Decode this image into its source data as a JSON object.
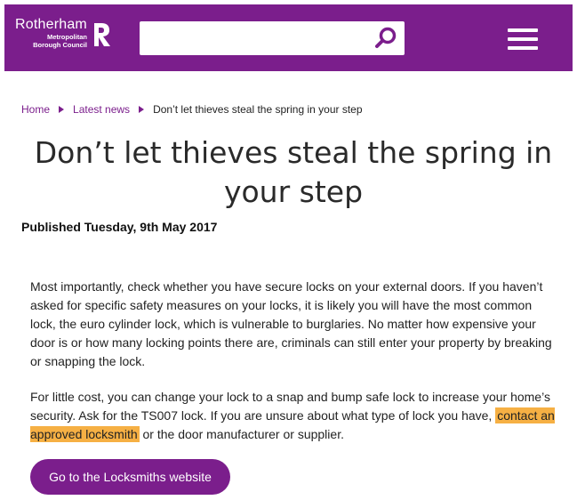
{
  "header": {
    "logo": {
      "name": "Rotherham",
      "sub_line1": "Metropolitan",
      "sub_line2": "Borough Council",
      "icon": "rotherham-r-mark-icon"
    },
    "search": {
      "value": "",
      "placeholder": "",
      "icon": "search-icon"
    },
    "menu_icon": "hamburger-menu-icon",
    "background": "#7b1e8c"
  },
  "breadcrumb": {
    "items": [
      "Home",
      "Latest news"
    ],
    "current": "Don’t let thieves steal the spring in your step",
    "separator_icon": "triangle-right-icon"
  },
  "article": {
    "title": "Don’t let thieves steal the spring in your step",
    "published": "Published Tuesday, 9th May 2017",
    "para1": "Most importantly, check whether you have secure locks on your external doors. If you haven’t asked for specific safety measures on your locks, it is likely you will have the most common lock, the euro cylinder lock, which is vulnerable to burglaries. No matter how expensive your door is or how many locking points there are, criminals can still enter your property by breaking or snapping the lock.",
    "para2_before": "For little cost, you can change your lock to a snap and bump safe lock to increase your home’s security. Ask for the TS007 lock. If you are unsure about what type of lock you have,",
    "para2_link": "contact an approved locksmith",
    "para2_after": "or the door manufacturer or supplier.",
    "cta_label": "Go to the Locksmiths website"
  },
  "colors": {
    "brand": "#7b1e8c",
    "link_highlight": "#f6b044"
  }
}
